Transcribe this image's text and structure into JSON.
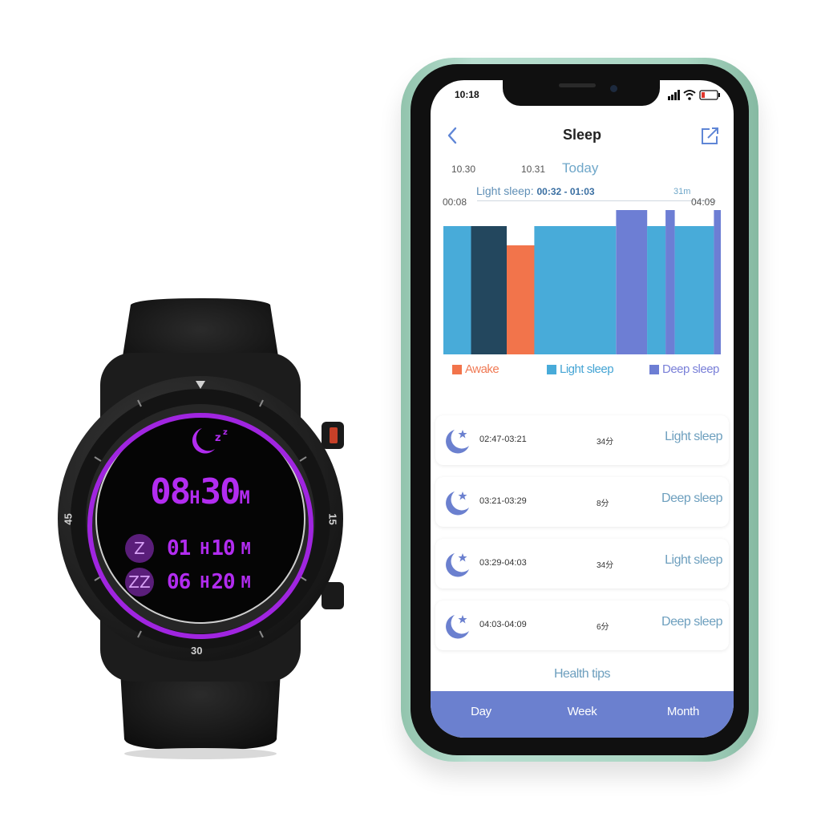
{
  "watch": {
    "total_hours": "08",
    "total_minutes": "30",
    "unit_h": "H",
    "unit_m": "M",
    "light_icon": "Z",
    "light_hours": "01",
    "light_minutes": "10",
    "deep_icon": "ZZ",
    "deep_hours": "06",
    "deep_minutes": "20",
    "bezel_marks": [
      "15",
      "30",
      "45"
    ],
    "accent_color": "#b22cf0",
    "moon_icon": "sleep-moon-icon"
  },
  "phone": {
    "status_time": "10:18",
    "title": "Sleep",
    "dates": [
      "10.30",
      "10.31",
      "Today"
    ],
    "tooltip": {
      "label": "Light sleep:",
      "range": "00:32 - 01:03",
      "duration": "31m"
    },
    "time_start": "00:08",
    "time_end": "04:09",
    "legend": [
      "Awake",
      "Light sleep",
      "Deep sleep"
    ],
    "colors": {
      "awake": "#f2744b",
      "light": "#48abd9",
      "deep": "#6d7ed4",
      "selected": "#23475e",
      "tabbar": "#6b80cf"
    },
    "sessions": [
      {
        "range": "02:47-03:21",
        "duration": "34分",
        "type": "Light sleep"
      },
      {
        "range": "03:21-03:29",
        "duration": "8分",
        "type": "Deep sleep"
      },
      {
        "range": "03:29-04:03",
        "duration": "34分",
        "type": "Light sleep"
      },
      {
        "range": "04:03-04:09",
        "duration": "6分",
        "type": "Deep sleep"
      }
    ],
    "health_tips": "Health tips",
    "tabs": [
      "Day",
      "Week",
      "Month"
    ]
  },
  "chart_data": {
    "type": "bar",
    "x_unit": "time",
    "start": "00:08",
    "end": "04:09",
    "segments": [
      {
        "start": "00:08",
        "end": "00:32",
        "stage": "light",
        "level": 2
      },
      {
        "start": "00:32",
        "end": "01:03",
        "stage": "light",
        "level": 2,
        "selected": true
      },
      {
        "start": "01:03",
        "end": "01:27",
        "stage": "awake",
        "level": 1.7
      },
      {
        "start": "01:27",
        "end": "02:38",
        "stage": "light",
        "level": 2
      },
      {
        "start": "02:38",
        "end": "03:05",
        "stage": "deep",
        "level": 2.25
      },
      {
        "start": "03:05",
        "end": "03:21",
        "stage": "light",
        "level": 2
      },
      {
        "start": "03:21",
        "end": "03:29",
        "stage": "deep",
        "level": 2.25
      },
      {
        "start": "03:29",
        "end": "04:03",
        "stage": "light",
        "level": 2
      },
      {
        "start": "04:03",
        "end": "04:09",
        "stage": "deep",
        "level": 2.25
      }
    ],
    "legend": [
      "Awake",
      "Light sleep",
      "Deep sleep"
    ],
    "ylim": [
      0,
      2.25
    ]
  }
}
